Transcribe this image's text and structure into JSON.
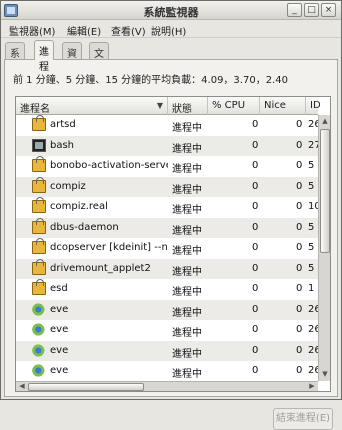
{
  "window": {
    "title": "系統監視器"
  },
  "menu": [
    {
      "label": "監視器(M)"
    },
    {
      "label": "編輯(E)"
    },
    {
      "label": "查看(V)"
    },
    {
      "label": "說明(H)"
    }
  ],
  "tabs": [
    {
      "label": "系統",
      "active": false
    },
    {
      "label": "進程",
      "active": true
    },
    {
      "label": "資源",
      "active": false
    },
    {
      "label": "文件系統",
      "active": false
    }
  ],
  "load_text": "前 1 分鐘、5 分鐘、15 分鐘的平均負載：4.09，3.70，2.40",
  "columns": [
    {
      "label": "進程名"
    },
    {
      "label": "狀態"
    },
    {
      "label": "% CPU"
    },
    {
      "label": "Nice"
    },
    {
      "label": "ID"
    }
  ],
  "processes": [
    {
      "icon": "package-icon",
      "name": "artsd",
      "status": "進程中",
      "cpu": "0",
      "nice": "0",
      "id": "26"
    },
    {
      "icon": "terminal-icon",
      "name": "bash",
      "status": "進程中",
      "cpu": "0",
      "nice": "0",
      "id": "27"
    },
    {
      "icon": "package-icon",
      "name": "bonobo-activation-server",
      "status": "進程中",
      "cpu": "0",
      "nice": "0",
      "id": "5"
    },
    {
      "icon": "package-icon",
      "name": "compiz",
      "status": "進程中",
      "cpu": "0",
      "nice": "0",
      "id": "5"
    },
    {
      "icon": "package-icon",
      "name": "compiz.real",
      "status": "進程中",
      "cpu": "0",
      "nice": "0",
      "id": "10"
    },
    {
      "icon": "package-icon",
      "name": "dbus-daemon",
      "status": "進程中",
      "cpu": "0",
      "nice": "0",
      "id": "5"
    },
    {
      "icon": "package-icon",
      "name": "dcopserver [kdeinit] --no",
      "status": "進程中",
      "cpu": "0",
      "nice": "0",
      "id": "5"
    },
    {
      "icon": "package-icon",
      "name": "drivemount_applet2",
      "status": "進程中",
      "cpu": "0",
      "nice": "0",
      "id": "5"
    },
    {
      "icon": "package-icon",
      "name": "esd",
      "status": "進程中",
      "cpu": "0",
      "nice": "0",
      "id": "1"
    },
    {
      "icon": "eye-icon",
      "name": "eve",
      "status": "進程中",
      "cpu": "0",
      "nice": "0",
      "id": "26"
    },
    {
      "icon": "eye-icon",
      "name": "eve",
      "status": "進程中",
      "cpu": "0",
      "nice": "0",
      "id": "26"
    },
    {
      "icon": "eye-icon",
      "name": "eve",
      "status": "進程中",
      "cpu": "0",
      "nice": "0",
      "id": "26"
    },
    {
      "icon": "eye-icon",
      "name": "eve",
      "status": "進程中",
      "cpu": "0",
      "nice": "0",
      "id": "26"
    }
  ],
  "end_button": "結束進程(E)"
}
